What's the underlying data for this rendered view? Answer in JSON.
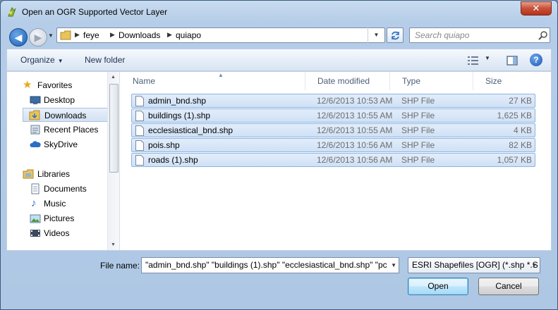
{
  "window": {
    "title": "Open an OGR Supported Vector Layer",
    "close_label": "✕"
  },
  "address": {
    "crumbs": [
      "feye",
      "Downloads",
      "quiapo"
    ]
  },
  "search": {
    "placeholder": "Search quiapo"
  },
  "toolbar": {
    "organize_label": "Organize",
    "new_folder_label": "New folder"
  },
  "sidebar": {
    "favorites_label": "Favorites",
    "favorites": [
      "Desktop",
      "Downloads",
      "Recent Places",
      "SkyDrive"
    ],
    "libraries_label": "Libraries",
    "libraries": [
      "Documents",
      "Music",
      "Pictures",
      "Videos"
    ],
    "selected": "Downloads"
  },
  "columns": {
    "name": "Name",
    "date": "Date modified",
    "type": "Type",
    "size": "Size"
  },
  "files": [
    {
      "name": "admin_bnd.shp",
      "date": "12/6/2013 10:53 AM",
      "type": "SHP File",
      "size": "27 KB"
    },
    {
      "name": "buildings (1).shp",
      "date": "12/6/2013 10:55 AM",
      "type": "SHP File",
      "size": "1,625 KB"
    },
    {
      "name": "ecclesiastical_bnd.shp",
      "date": "12/6/2013 10:55 AM",
      "type": "SHP File",
      "size": "4 KB"
    },
    {
      "name": "pois.shp",
      "date": "12/6/2013 10:56 AM",
      "type": "SHP File",
      "size": "82 KB"
    },
    {
      "name": "roads (1).shp",
      "date": "12/6/2013 10:56 AM",
      "type": "SHP File",
      "size": "1,057 KB"
    }
  ],
  "footer": {
    "file_name_label": "File name:",
    "file_name_value": "\"admin_bnd.shp\" \"buildings (1).shp\" \"ecclesiastical_bnd.shp\" \"pc",
    "filter_value": "ESRI Shapefiles [OGR] (*.shp *.S",
    "open_label": "Open",
    "cancel_label": "Cancel"
  },
  "colors": {
    "selection": "#cfe1f6",
    "selection_border": "#8fb4e0",
    "accent": "#1b5fb5"
  }
}
